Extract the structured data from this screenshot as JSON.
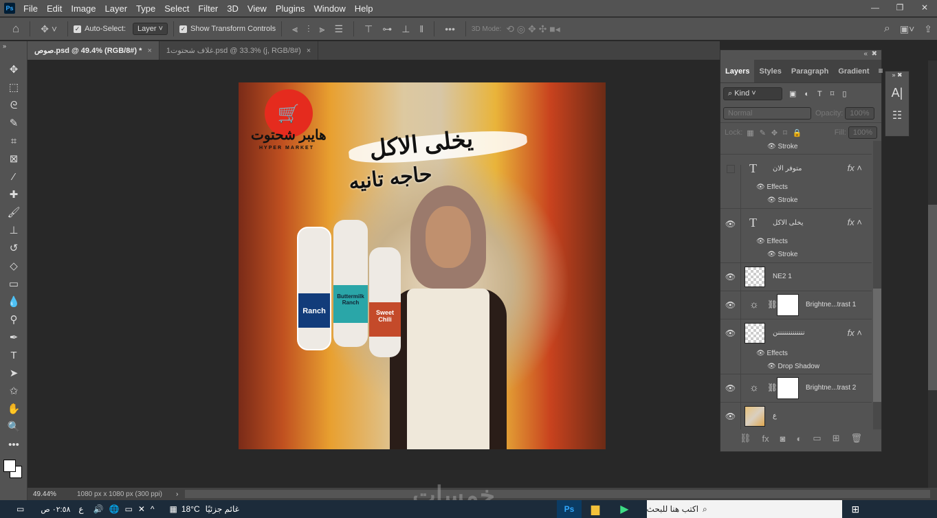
{
  "menu": [
    "File",
    "Edit",
    "Image",
    "Layer",
    "Type",
    "Select",
    "Filter",
    "3D",
    "View",
    "Plugins",
    "Window",
    "Help"
  ],
  "app_icon": "Ps",
  "options": {
    "auto_select": "Auto-Select:",
    "auto_select_target": "Layer",
    "show_transform": "Show Transform Controls",
    "mode_3d": "3D Mode:"
  },
  "tabs": [
    {
      "label": "صوص.psd @ 49.4% (RGB/8#) *",
      "active": true
    },
    {
      "label": "غلاف شحتوت1.psd @ 33.3% (j, RGB/8#)",
      "active": false
    }
  ],
  "artwork": {
    "logo_name": "هايبر شحتوت",
    "logo_sub": "HYPER MARKET",
    "headline1": "يخلى الاكل",
    "headline2": "حاجه تانيه",
    "bottles": [
      "Ranch",
      "Buttermilk Ranch",
      "Sweet Chili"
    ]
  },
  "layers_panel": {
    "tabs": [
      "Layers",
      "Styles",
      "Paragraph",
      "Gradient"
    ],
    "filter": "Kind",
    "blend": "Normal",
    "opacity_label": "Opacity:",
    "opacity": "100%",
    "lock_label": "Lock:",
    "fill_label": "Fill:",
    "fill": "100%",
    "top_effect": "Stroke",
    "layers": [
      {
        "name": "متوفر الان",
        "type": "text",
        "visible": false,
        "effects": "Effects",
        "effect": "Stroke"
      },
      {
        "name": "يخلى الاكل",
        "type": "text",
        "visible": true,
        "effects": "Effects",
        "effect": "Stroke"
      },
      {
        "name": "NE2 1",
        "type": "image",
        "visible": true
      },
      {
        "name": "Brightne...trast 1",
        "type": "adjustment",
        "visible": true
      },
      {
        "name": "نننننننننننننن",
        "type": "smart",
        "visible": true,
        "effects": "Effects",
        "effect": "Drop Shadow"
      },
      {
        "name": "Brightne...trast 2",
        "type": "adjustment",
        "visible": true
      },
      {
        "name": "ع",
        "type": "smart",
        "visible": true
      }
    ]
  },
  "status": {
    "zoom": "49.44%",
    "doc_info": "1080 px x 1080 px (300 ppi)"
  },
  "watermark": "خمسات",
  "taskbar": {
    "search_placeholder": "اكتب هنا للبحث",
    "weather_temp": "18°C",
    "weather_text": "غائم جزئيًا",
    "time": "٠٢:٥٨",
    "ampm": "ص",
    "lang": "ع"
  }
}
